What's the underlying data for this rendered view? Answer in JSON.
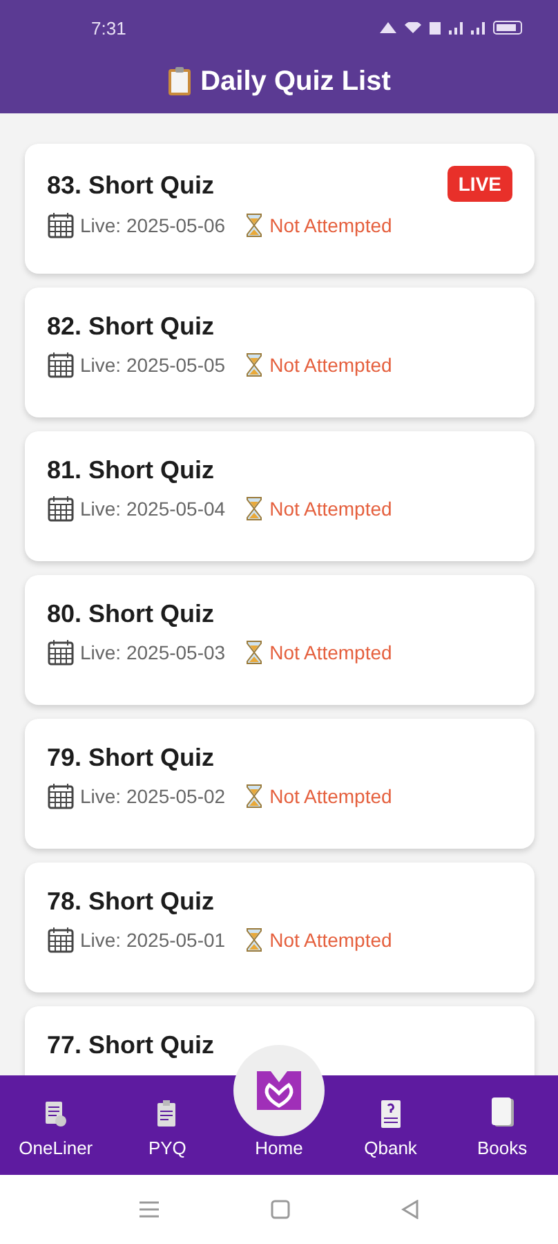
{
  "status_bar": {
    "time": "7:31"
  },
  "header": {
    "title": "Daily Quiz List"
  },
  "quizzes": [
    {
      "title": "83. Short Quiz",
      "badge": "LIVE",
      "date": "Live: 2025-05-06",
      "status": "Not Attempted"
    },
    {
      "title": "82. Short Quiz",
      "date": "Live: 2025-05-05",
      "status": "Not Attempted"
    },
    {
      "title": "81. Short Quiz",
      "date": "Live: 2025-05-04",
      "status": "Not Attempted"
    },
    {
      "title": "80. Short Quiz",
      "date": "Live: 2025-05-03",
      "status": "Not Attempted"
    },
    {
      "title": "79. Short Quiz",
      "date": "Live: 2025-05-02",
      "status": "Not Attempted"
    },
    {
      "title": "78. Short Quiz",
      "date": "Live: 2025-05-01",
      "status": "Not Attempted"
    },
    {
      "title": "77. Short Quiz"
    }
  ],
  "bottom_nav": [
    {
      "label": "OneLiner",
      "kind": "oneliner"
    },
    {
      "label": "PYQ",
      "kind": "pyq"
    },
    {
      "label": "Home",
      "kind": "home"
    },
    {
      "label": "Qbank",
      "kind": "qbank"
    },
    {
      "label": "Books",
      "kind": "books"
    }
  ]
}
